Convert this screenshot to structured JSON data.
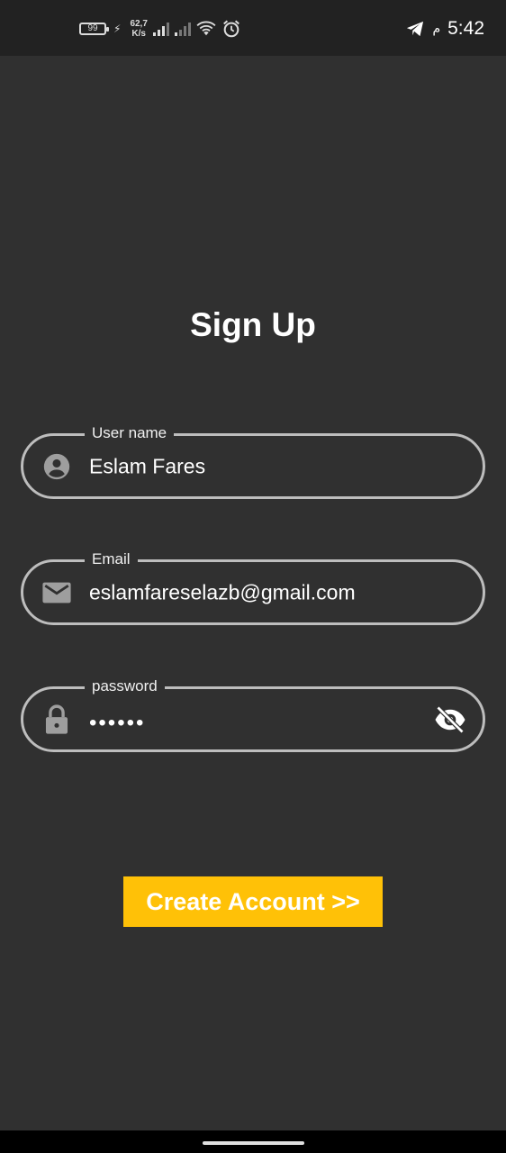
{
  "status_bar": {
    "battery": "99",
    "speed_value": "62,7",
    "speed_unit": "K/s",
    "am_pm": "م",
    "time": "5:42",
    "icons": [
      "battery-icon",
      "charging-icon",
      "signal-icon",
      "signal-icon",
      "wifi-icon",
      "alarm-icon",
      "telegram-icon"
    ]
  },
  "page": {
    "title": "Sign Up"
  },
  "form": {
    "username": {
      "label": "User name",
      "value": "Eslam Fares",
      "icon": "account-circle-icon"
    },
    "email": {
      "label": "Email",
      "value": "eslamfareselazb@gmail.com",
      "icon": "mail-icon"
    },
    "password": {
      "label": "password",
      "value": "••••••",
      "icon": "lock-icon",
      "toggle_icon": "eye-off-icon"
    }
  },
  "actions": {
    "create_account": "Create Account >>"
  },
  "colors": {
    "background": "#303030",
    "status_bar": "#222222",
    "accent": "#ffc107",
    "field_border": "#bdbdbd",
    "icon_gray": "#9e9e9e"
  }
}
